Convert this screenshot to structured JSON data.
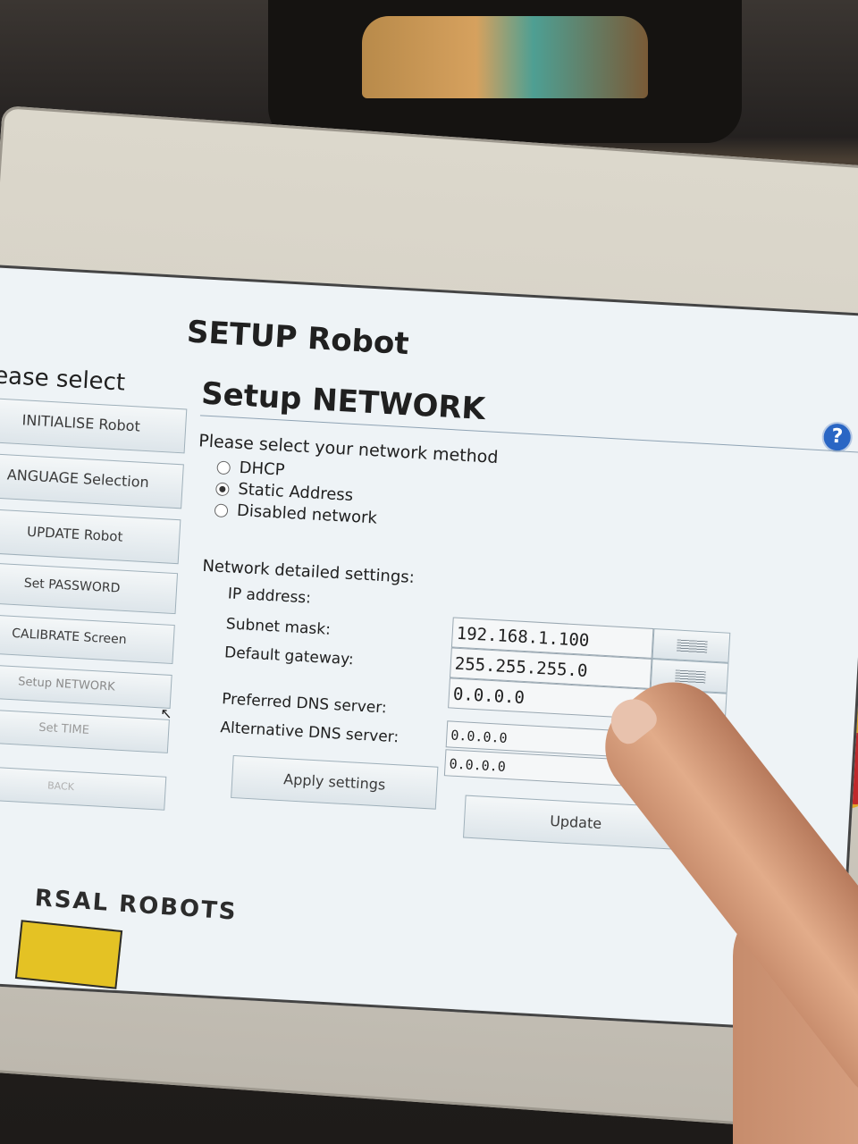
{
  "app": {
    "title": "SETUP Robot",
    "help_icon": "?"
  },
  "sidebar": {
    "title": "lease select",
    "items": [
      {
        "label": "INITIALISE Robot"
      },
      {
        "label": "ANGUAGE Selection"
      },
      {
        "label": "UPDATE Robot"
      },
      {
        "label": "Set PASSWORD"
      },
      {
        "label": "CALIBRATE Screen"
      },
      {
        "label": "Setup NETWORK"
      },
      {
        "label": "Set TIME"
      },
      {
        "label": "BACK"
      }
    ]
  },
  "network": {
    "title": "Setup NETWORK",
    "prompt": "Please select your network method",
    "methods": [
      {
        "label": "DHCP",
        "selected": false
      },
      {
        "label": "Static Address",
        "selected": true
      },
      {
        "label": "Disabled network",
        "selected": false
      }
    ],
    "details_title": "Network detailed settings:",
    "fields": {
      "ip_address": {
        "label": "IP address:",
        "value": "192.168.1.100"
      },
      "subnet_mask": {
        "label": "Subnet mask:",
        "value": "255.255.255.0"
      },
      "default_gateway": {
        "label": "Default gateway:",
        "value": "0.0.0.0"
      },
      "preferred_dns": {
        "label": "Preferred DNS server:",
        "value": "0.0.0.0"
      },
      "alternative_dns": {
        "label": "Alternative DNS server:",
        "value": "0.0.0.0"
      }
    },
    "apply_label": "Apply settings",
    "update_label": "Update"
  },
  "hardware": {
    "brand": "RSAL ROBOTS"
  },
  "icons": {
    "help": "help-icon",
    "keyboard": "keyboard-icon",
    "cursor": "mouse-cursor-icon"
  }
}
